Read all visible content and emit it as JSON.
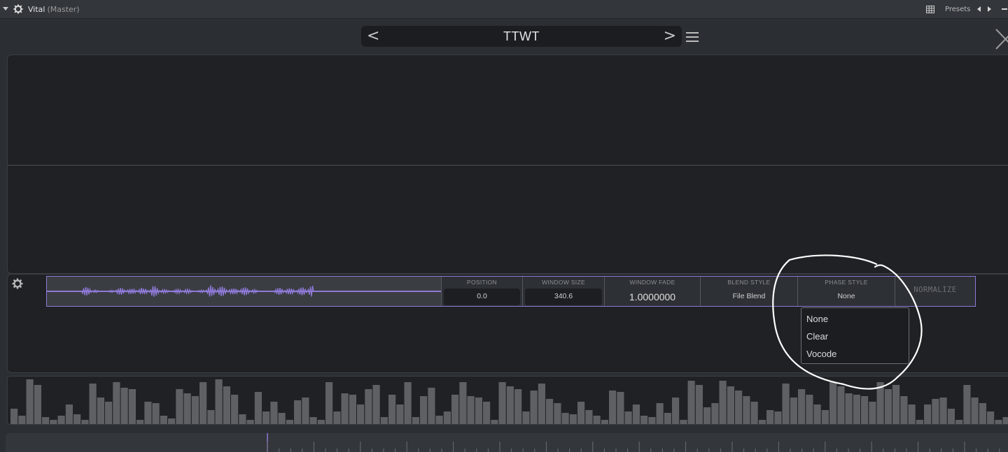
{
  "host": {
    "plugin_name": "Vital",
    "instance": "(Master)",
    "presets_label": "Presets",
    "icons": [
      "collapse-arrow-icon",
      "gear-icon",
      "grid-icon",
      "prev-preset-icon",
      "next-preset-icon",
      "minimize-icon"
    ]
  },
  "header": {
    "preset_name": "TTWT",
    "prev": "<",
    "next": ">"
  },
  "source": {
    "position": {
      "label": "POSITION",
      "value": "0.0"
    },
    "window_size": {
      "label": "WINDOW SIZE",
      "value": "340.6"
    },
    "window_fade": {
      "label": "WINDOW FADE",
      "value": "1.0000000"
    },
    "blend_style": {
      "label": "BLEND STYLE",
      "value": "File Blend"
    },
    "phase_style": {
      "label": "PHASE STYLE",
      "value": "None"
    },
    "normalize": "NORMALIZE"
  },
  "phase_dropdown": {
    "options": [
      "None",
      "Clear",
      "Vocode"
    ]
  },
  "colors": {
    "accent": "#8f7ad8",
    "panel": "#1f2125",
    "background": "#2b2e33",
    "bars": "#5e6064",
    "annotation": "#ffffff"
  }
}
